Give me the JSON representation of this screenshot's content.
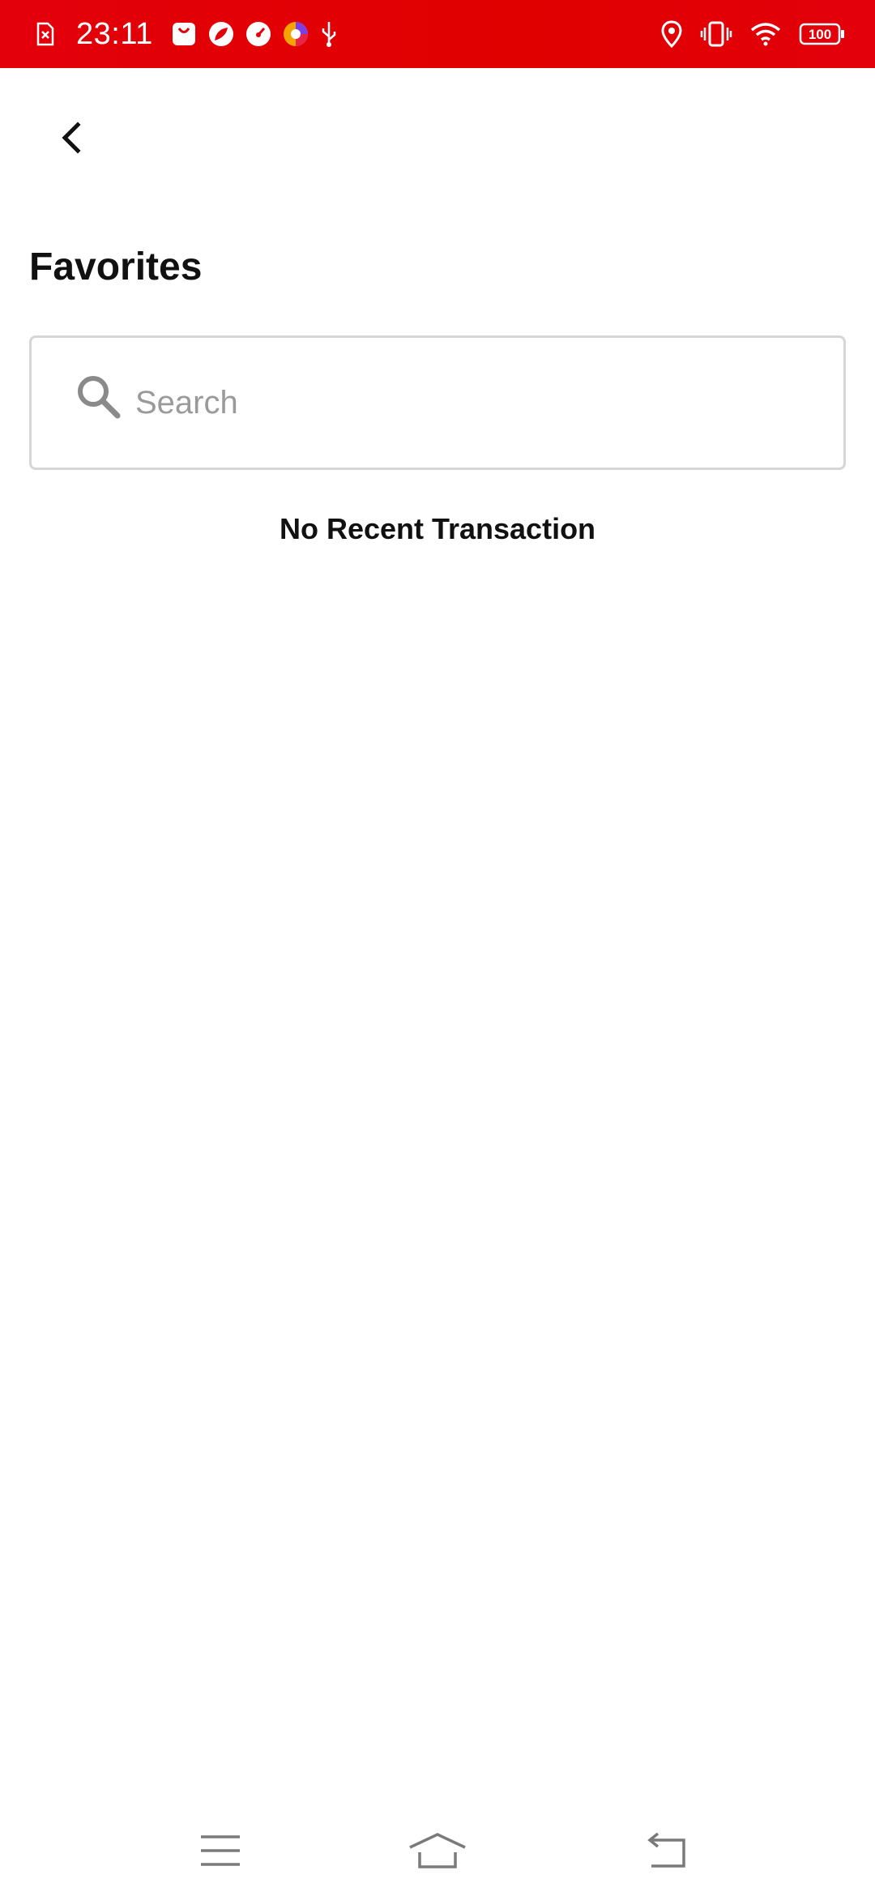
{
  "status_bar": {
    "time": "23:11",
    "battery": "100",
    "background_color": "#e3000b",
    "left_icons": [
      "sim-error-icon",
      "shopping-bag-icon",
      "leaf-app-icon",
      "gauge-app-icon",
      "browser-app-icon",
      "usb-icon"
    ],
    "right_icons": [
      "location-icon",
      "vibrate-icon",
      "wifi-icon",
      "battery-icon"
    ]
  },
  "header": {
    "back_icon": "chevron-left-icon"
  },
  "page": {
    "title": "Favorites"
  },
  "search": {
    "placeholder": "Search",
    "value": "",
    "icon": "search-icon"
  },
  "empty_state": {
    "message": "No Recent Transaction"
  },
  "nav_bar": {
    "icons": [
      "menu-icon",
      "home-icon",
      "back-icon"
    ]
  }
}
